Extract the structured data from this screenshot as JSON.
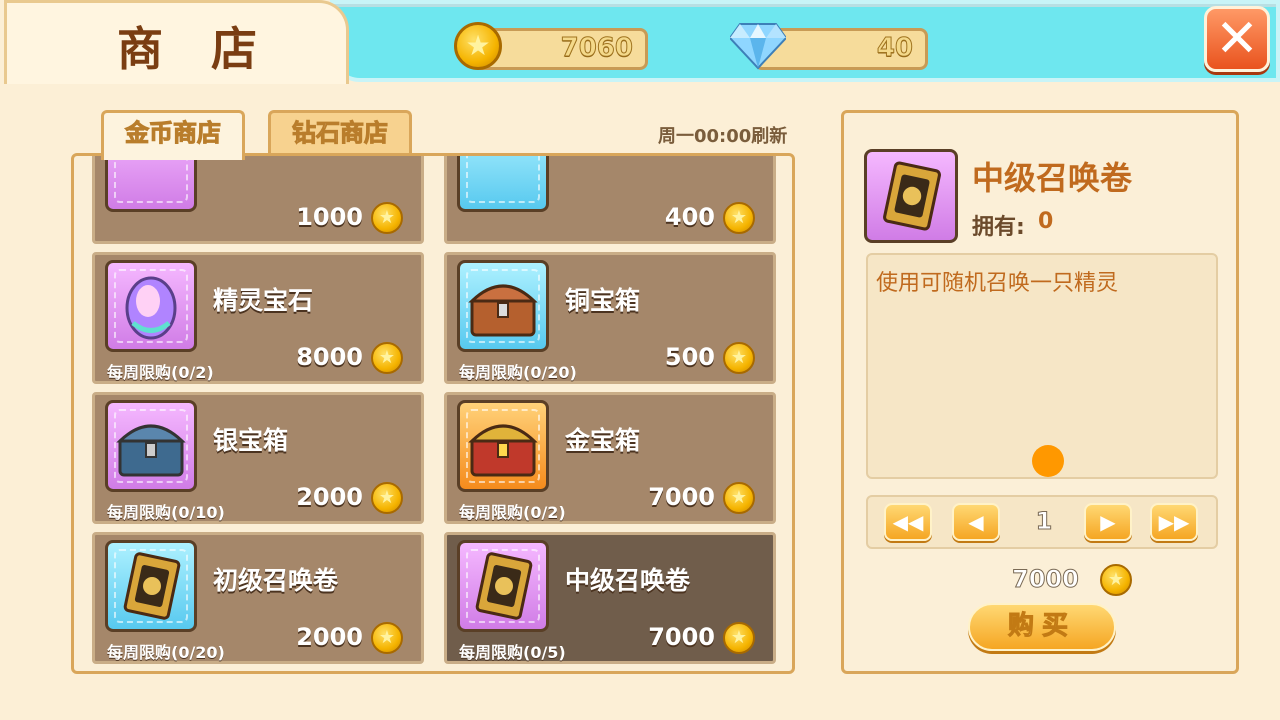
{
  "title": "商 店",
  "resources": {
    "gold": "7060",
    "diamond": "40",
    "gold_icon": "gold-coin-icon",
    "diamond_icon": "diamond-icon"
  },
  "close_label": "✕",
  "tabs": [
    {
      "label": "金币商店",
      "active": true
    },
    {
      "label": "钻石商店",
      "active": false
    }
  ],
  "refresh_text": "周一00:00刷新",
  "items": [
    {
      "name": "",
      "limit": "",
      "price": "1000",
      "icon": "gem-icon",
      "color": "purple"
    },
    {
      "name": "",
      "limit": "",
      "price": "400",
      "icon": "gem-icon",
      "color": "blue"
    },
    {
      "name": "精灵宝石",
      "limit": "每周限购(0/2)",
      "price": "8000",
      "icon": "spirit-gem-icon",
      "color": "purple"
    },
    {
      "name": "铜宝箱",
      "limit": "每周限购(0/20)",
      "price": "500",
      "icon": "copper-chest-icon",
      "color": "blue"
    },
    {
      "name": "银宝箱",
      "limit": "每周限购(0/10)",
      "price": "2000",
      "icon": "silver-chest-icon",
      "color": "purple"
    },
    {
      "name": "金宝箱",
      "limit": "每周限购(0/2)",
      "price": "7000",
      "icon": "gold-chest-icon",
      "color": "orange"
    },
    {
      "name": "初级召唤卷",
      "limit": "每周限购(0/20)",
      "price": "2000",
      "icon": "summon-scroll-icon",
      "color": "blue"
    },
    {
      "name": "中级召唤卷",
      "limit": "每周限购(0/5)",
      "price": "7000",
      "icon": "summon-scroll-icon",
      "color": "purple",
      "selected": true
    }
  ],
  "detail": {
    "name": "中级召唤卷",
    "own_label": "拥有:",
    "own_value": "0",
    "description": "使用可随机召唤一只精灵",
    "quantity": "1",
    "price": "7000",
    "buy_label": "购买"
  },
  "pager": {
    "first": "◀◀",
    "prev": "◀",
    "next": "▶",
    "last": "▶▶"
  },
  "colors": {
    "accent_cyan": "#6ee7ef",
    "price_coin": "#f5b400",
    "detail_name": "#c06a1e",
    "close_red": "#e9531e"
  }
}
